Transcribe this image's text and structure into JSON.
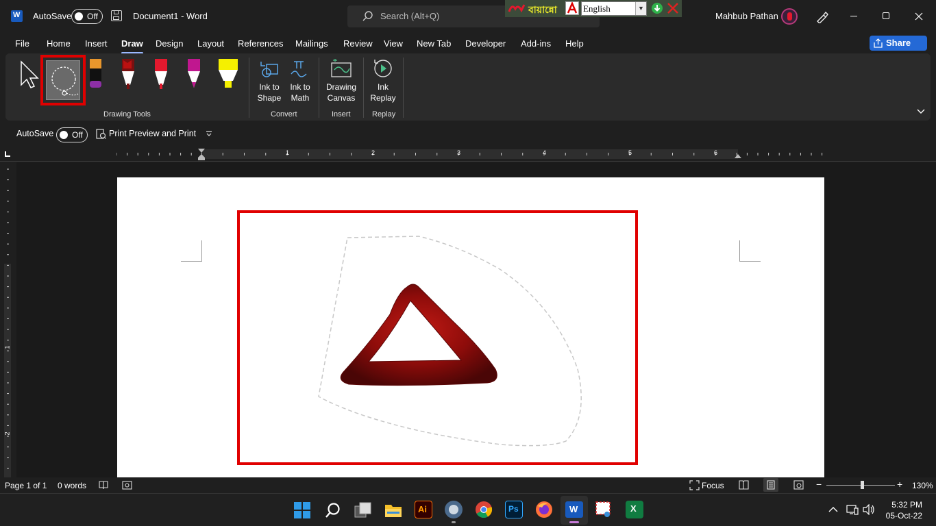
{
  "titlebar": {
    "autosave_label": "AutoSave",
    "autosave_state": "Off",
    "doc_title": "Document1  -  Word",
    "search_placeholder": "Search (Alt+Q)",
    "bangla_tool": {
      "logo_text": "বায়ান্নো",
      "language": "English"
    },
    "user_name": "Mahbub Pathan"
  },
  "menu": {
    "tabs": [
      "File",
      "Home",
      "Insert",
      "Draw",
      "Design",
      "Layout",
      "References",
      "Mailings",
      "Review",
      "View",
      "New Tab",
      "Developer",
      "Add-ins",
      "Help"
    ],
    "active": "Draw",
    "share_label": "Share"
  },
  "ribbon": {
    "groups": {
      "drawing_tools": "Drawing Tools",
      "convert": "Convert",
      "insert": "Insert",
      "replay": "Replay"
    },
    "buttons": {
      "ink_to_shape_1": "Ink to",
      "ink_to_shape_2": "Shape",
      "ink_to_math_1": "Ink to",
      "ink_to_math_2": "Math",
      "drawing_canvas_1": "Drawing",
      "drawing_canvas_2": "Canvas",
      "ink_replay_1": "Ink",
      "ink_replay_2": "Replay"
    },
    "colors": {
      "selection_highlight": "#e00000",
      "pen_orange": "#e8962c",
      "pen_purple": "#8e2fa6",
      "pen_red": "#e3192e",
      "pen_magenta": "#c0178f",
      "highlighter_yellow": "#f5f000"
    }
  },
  "qat": {
    "autosave_label": "AutoSave",
    "autosave_state": "Off",
    "print_preview": "Print Preview and Print"
  },
  "ruler": {
    "numbers": [
      "1",
      "2",
      "3",
      "4",
      "5",
      "6"
    ],
    "vnumbers": [
      "1",
      "2"
    ]
  },
  "status": {
    "page": "Page 1 of 1",
    "words": "0 words",
    "focus": "Focus",
    "zoom": "130%"
  },
  "taskbar": {
    "time": "5:32 PM",
    "date": "05-Oct-22"
  }
}
